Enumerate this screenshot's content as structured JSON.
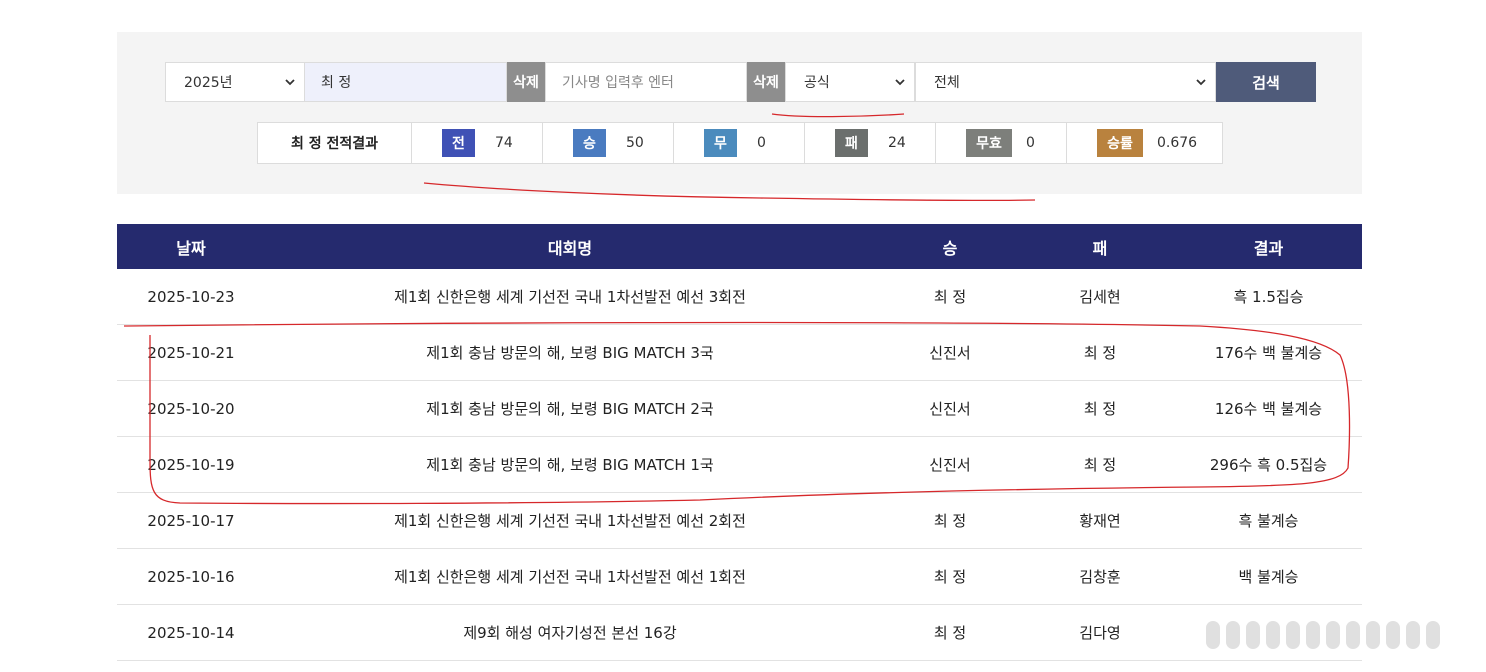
{
  "filters": {
    "year": "2025년",
    "player_name": "최 정",
    "delete_label": "삭제",
    "player_placeholder": "기사명 입력후 엔터",
    "game_type": "공식",
    "tournament": "전체",
    "search_label": "검색"
  },
  "stats": {
    "title": "최 정 전적결과",
    "items": [
      {
        "label": "전",
        "value": "74",
        "color": "#3f51b5"
      },
      {
        "label": "승",
        "value": "50",
        "color": "#4a7bc0"
      },
      {
        "label": "무",
        "value": "0",
        "color": "#4b8bbd"
      },
      {
        "label": "패",
        "value": "24",
        "color": "#6b6f6d"
      },
      {
        "label": "무효",
        "value": "0",
        "color": "#7d7f7b"
      },
      {
        "label": "승률",
        "value": "0.676",
        "color": "#b9823e"
      }
    ]
  },
  "table": {
    "headers": [
      "날짜",
      "대회명",
      "승",
      "패",
      "결과"
    ],
    "rows": [
      [
        "2025-10-23",
        "제1회 신한은행 세계 기선전 국내 1차선발전 예선 3회전",
        "최 정",
        "김세현",
        "흑 1.5집승"
      ],
      [
        "2025-10-21",
        "제1회 충남 방문의 해, 보령 BIG MATCH 3국",
        "신진서",
        "최 정",
        "176수 백 불계승"
      ],
      [
        "2025-10-20",
        "제1회 충남 방문의 해, 보령 BIG MATCH 2국",
        "신진서",
        "최 정",
        "126수 백 불계승"
      ],
      [
        "2025-10-19",
        "제1회 충남 방문의 해, 보령 BIG MATCH 1국",
        "신진서",
        "최 정",
        "296수 흑 0.5집승"
      ],
      [
        "2025-10-17",
        "제1회 신한은행 세계 기선전 국내 1차선발전 예선 2회전",
        "최 정",
        "황재연",
        "흑 불계승"
      ],
      [
        "2025-10-16",
        "제1회 신한은행 세계 기선전 국내 1차선발전 예선 1회전",
        "최 정",
        "김창훈",
        "백 불계승"
      ],
      [
        "2025-10-14",
        "제9회 해성 여자기성전 본선 16강",
        "최 정",
        "김다영",
        ""
      ]
    ]
  },
  "colors": {
    "header_bg": "#252a6e",
    "search_button": "#4f5b7a",
    "delete_button": "#8e8e8e",
    "annotation": "#d6282b"
  }
}
